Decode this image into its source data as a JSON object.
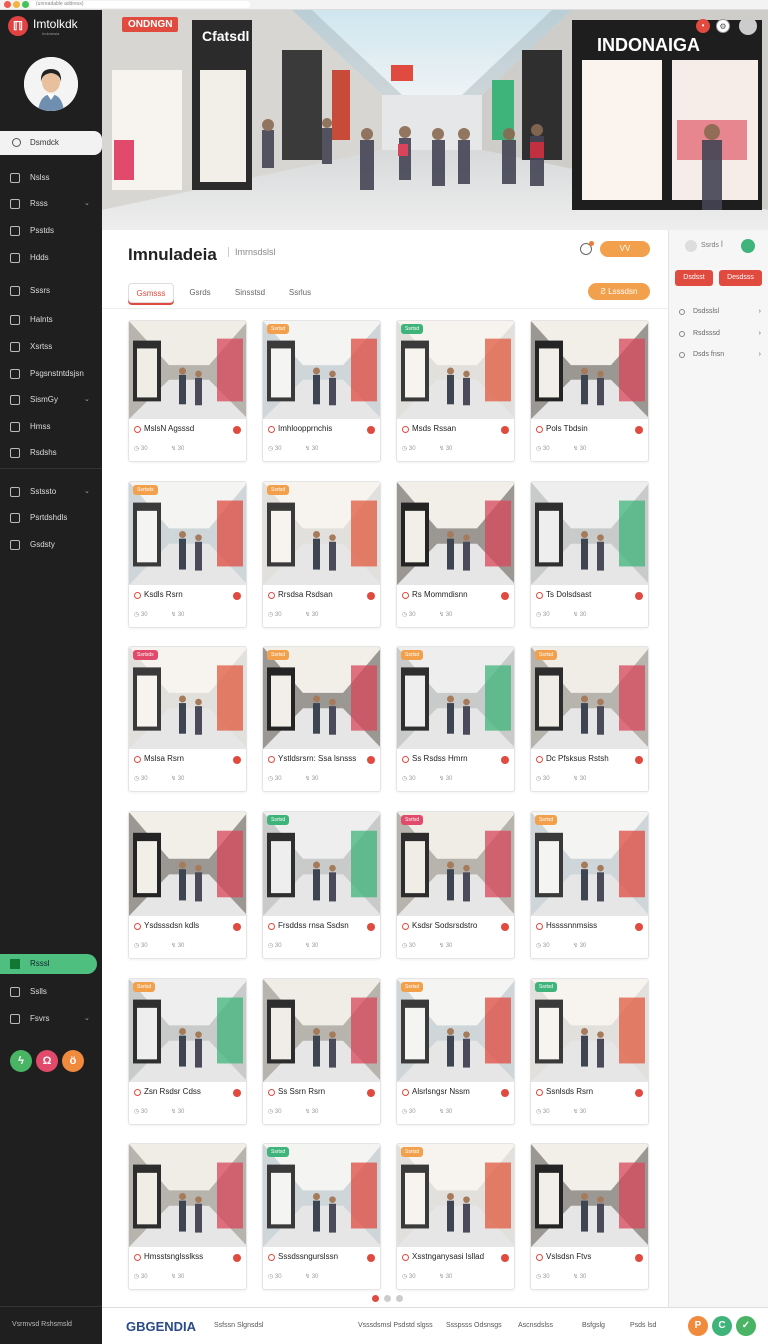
{
  "browser": {
    "url": "(unreadable address)"
  },
  "app": {
    "name": "Imtolkdk",
    "tagline": "Indonesia"
  },
  "sidebar": {
    "active_item": "Dsmdck",
    "items": [
      {
        "label": "Nslss",
        "chevron": ""
      },
      {
        "label": "Rsss",
        "chevron": "⌄"
      },
      {
        "label": "Psstds",
        "chevron": ""
      },
      {
        "label": "Hdds",
        "chevron": ""
      },
      {
        "label": "Sssrs",
        "chevron": ""
      },
      {
        "label": "Halnts",
        "chevron": ""
      },
      {
        "label": "Xsrtss",
        "chevron": ""
      },
      {
        "label": "Psgsnstntdsjsn",
        "chevron": ""
      },
      {
        "label": "SismGy",
        "chevron": "⌄"
      },
      {
        "label": "Hmss",
        "chevron": ""
      },
      {
        "label": "Rsdshs",
        "chevron": ""
      },
      {
        "label": "Sstssto",
        "chevron": "⌄"
      },
      {
        "label": "Psrtdshdls",
        "chevron": ""
      },
      {
        "label": "Gsdsty",
        "chevron": ""
      }
    ],
    "green_item": "Rsssl",
    "lower_items": [
      {
        "label": "Sslls",
        "chevron": ""
      },
      {
        "label": "Fsvrs",
        "chevron": "⌄"
      }
    ],
    "circle_buttons": [
      {
        "glyph": "ϟ",
        "color": "#49b463"
      },
      {
        "glyph": "Ω",
        "color": "#e14a6a"
      },
      {
        "glyph": "ö",
        "color": "#f08a3d"
      }
    ],
    "footer": "Vsrmvsd Rshsmsld"
  },
  "hero": {
    "badge": "ONDNGN",
    "sign_left": "Cfatsdl",
    "sign_right": "INDONAIGA",
    "icons": [
      "search-icon",
      "settings-icon",
      "user-avatar-icon"
    ]
  },
  "main": {
    "title": "Imnuladeia",
    "subtitle": "Imrnsdslsl",
    "header_button": "VV",
    "tabs": [
      "Gsmsss",
      "Gsrds",
      "Sinsstsd",
      "Ssrlus"
    ],
    "tab_action": "Ƨ  Lsssdsn"
  },
  "cards": [
    {
      "badge": "",
      "badge_color": "",
      "title": "MslsN Agsssd",
      "views": "30",
      "likes": "30"
    },
    {
      "badge": "Ssrtsd",
      "badge_color": "#f2a04c",
      "title": "Imhloopprnchis",
      "views": "30",
      "likes": "30"
    },
    {
      "badge": "Ssrtsd",
      "badge_color": "#3fb47a",
      "title": "Msds Rssan",
      "views": "30",
      "likes": "30"
    },
    {
      "badge": "",
      "badge_color": "",
      "title": "Pols Tbdsin",
      "views": "30",
      "likes": "30"
    },
    {
      "badge": "Ssrtsds",
      "badge_color": "#f2a04c",
      "title": "Ksdls Rsrn",
      "views": "30",
      "likes": "30"
    },
    {
      "badge": "Ssrtsd",
      "badge_color": "#f2a04c",
      "title": "Rrsdsa Rsdsan",
      "views": "30",
      "likes": "30"
    },
    {
      "badge": "",
      "badge_color": "",
      "title": "Rs Mommdisnn",
      "views": "30",
      "likes": "30"
    },
    {
      "badge": "",
      "badge_color": "",
      "title": "Ts Dolsdsast",
      "views": "30",
      "likes": "30"
    },
    {
      "badge": "Ssrtsds",
      "badge_color": "#e14a6a",
      "title": "Mslsa Rsrn",
      "views": "30",
      "likes": "30"
    },
    {
      "badge": "Ssrtsd",
      "badge_color": "#f2a04c",
      "title": "Ystldsrsrn: Ssa lsnsss",
      "views": "30",
      "likes": "30"
    },
    {
      "badge": "Ssrtsd",
      "badge_color": "#f2a04c",
      "title": "Ss Rsdss Hmrn",
      "views": "30",
      "likes": "30"
    },
    {
      "badge": "Ssrtsd",
      "badge_color": "#f2a04c",
      "title": "Dc Pfsksus Rstsh",
      "views": "30",
      "likes": "30"
    },
    {
      "badge": "",
      "badge_color": "",
      "title": "Ysdsssdsn kdls",
      "views": "30",
      "likes": "30"
    },
    {
      "badge": "Ssrtsd",
      "badge_color": "#3fb47a",
      "title": "Frsddss rnsa Ssdsn",
      "views": "30",
      "likes": "30"
    },
    {
      "badge": "Ssrtsd",
      "badge_color": "#e14a6a",
      "title": "Ksdsr Sodsrsdstro",
      "views": "30",
      "likes": "30"
    },
    {
      "badge": "Ssrtsd",
      "badge_color": "#f2a04c",
      "title": "Hssssnnmsiss",
      "views": "30",
      "likes": "30"
    },
    {
      "badge": "Ssrtsd",
      "badge_color": "#f2a04c",
      "title": "Zsn Rsdsr Cdss",
      "views": "30",
      "likes": "30"
    },
    {
      "badge": "",
      "badge_color": "",
      "title": "Ss Ssrn Rsrn",
      "views": "30",
      "likes": "30"
    },
    {
      "badge": "Ssrtsd",
      "badge_color": "#f2a04c",
      "title": "Alsrlsngsr Nssm",
      "views": "30",
      "likes": "30"
    },
    {
      "badge": "Ssrtsd",
      "badge_color": "#3fb47a",
      "title": "Ssnlsds Rsrn",
      "views": "30",
      "likes": "30"
    },
    {
      "badge": "",
      "badge_color": "",
      "title": "Hmsstsnglsslkss",
      "views": "30",
      "likes": "30"
    },
    {
      "badge": "Ssrtsd",
      "badge_color": "#3fb47a",
      "title": "Sssdssngurslssn",
      "views": "30",
      "likes": "30"
    },
    {
      "badge": "Ssrtsd",
      "badge_color": "#f2a04c",
      "title": "Xsstnganysasi lsllad",
      "views": "30",
      "likes": "30"
    },
    {
      "badge": "",
      "badge_color": "",
      "title": "Vslsdsn Ftvs",
      "views": "30",
      "likes": "30"
    }
  ],
  "right_panel": {
    "label": "Ssrds ꟾ",
    "buttons": [
      "Dsdsst",
      "Desdsss"
    ],
    "links": [
      "Dsdsslsl",
      "Rsdsssd",
      "Dsds fnsn"
    ]
  },
  "bottom_bar": {
    "logo": "GBGENDIA",
    "links": [
      "Ssfssn Slgnsdsl",
      "Vsssdsmsl Psdstd slgss",
      "Ssspsss Odsnsgs",
      "Ascnsdslss",
      "Bsfgslg",
      "Psds lsd"
    ],
    "circles": [
      {
        "glyph": "P",
        "color": "#f08a3d"
      },
      {
        "glyph": "C",
        "color": "#3fb47a"
      },
      {
        "glyph": "✓",
        "color": "#49b463"
      }
    ]
  },
  "colors": {
    "accent": "#e04a3f",
    "orange": "#f2a04c",
    "green": "#4fbf7f",
    "sidebar": "#1f1f1f"
  }
}
